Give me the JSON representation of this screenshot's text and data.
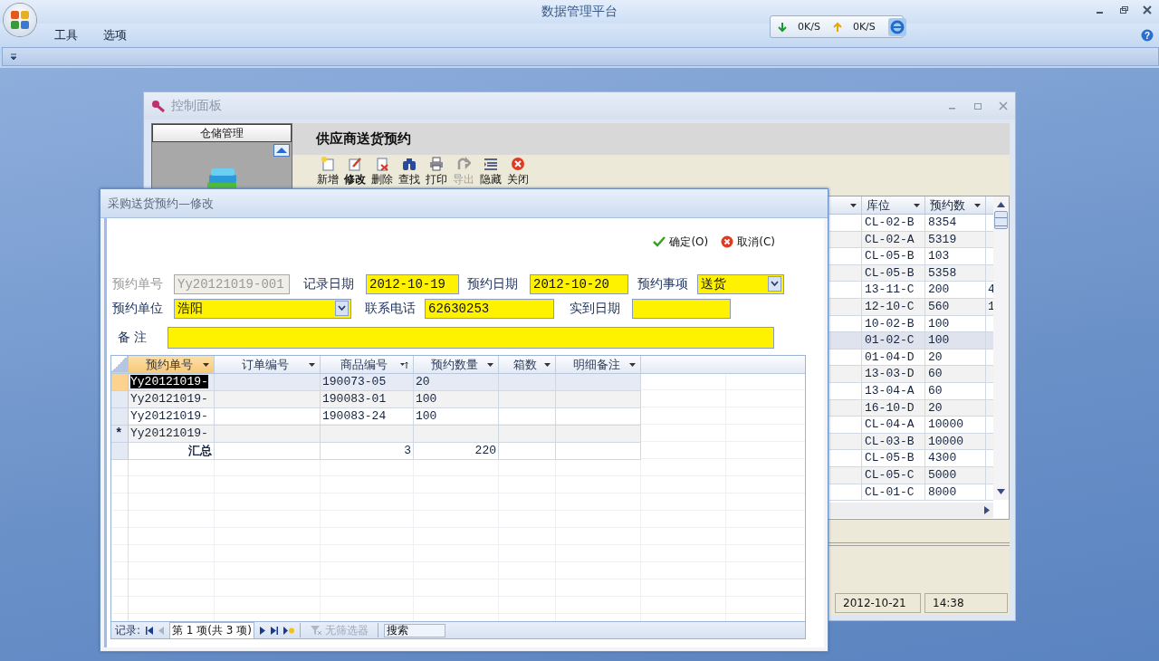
{
  "app": {
    "title": "数据管理平台",
    "menu": [
      {
        "label": "工具"
      },
      {
        "label": "选项"
      }
    ],
    "help": "?"
  },
  "net_speed": {
    "down": "0K/S",
    "up": "0K/S"
  },
  "control_panel": {
    "title": "控制面板",
    "nav_header": "仓储管理",
    "page_title": "供应商送货预约",
    "toolbar": [
      {
        "kind": "new",
        "label": "新增",
        "selected": false,
        "disabled": false
      },
      {
        "kind": "edit",
        "label": "修改",
        "selected": true,
        "disabled": false
      },
      {
        "kind": "delete",
        "label": "删除",
        "selected": false,
        "disabled": false
      },
      {
        "kind": "find",
        "label": "查找",
        "selected": false,
        "disabled": false
      },
      {
        "kind": "print",
        "label": "打印",
        "selected": false,
        "disabled": false
      },
      {
        "kind": "export",
        "label": "导出",
        "selected": false,
        "disabled": true
      },
      {
        "kind": "hide",
        "label": "隐藏",
        "selected": false,
        "disabled": false
      },
      {
        "kind": "close",
        "label": "关闭",
        "selected": false,
        "disabled": false
      }
    ],
    "grid": {
      "columns": [
        {
          "label": "库位"
        },
        {
          "label": "预约数"
        }
      ],
      "rows": [
        {
          "location": "CL-02-B",
          "qty": "8354",
          "selected": false
        },
        {
          "location": "CL-02-A",
          "qty": "5319",
          "selected": false
        },
        {
          "location": "CL-05-B",
          "qty": "103",
          "selected": false
        },
        {
          "location": "CL-05-B",
          "qty": "5358",
          "selected": false
        },
        {
          "location": "13-11-C",
          "qty": "200",
          "column_5": "4",
          "selected": false
        },
        {
          "location": "12-10-C",
          "qty": "560",
          "column_5": "1",
          "selected": false
        },
        {
          "location": "10-02-B",
          "qty": "100",
          "selected": false
        },
        {
          "location": "01-02-C",
          "qty": "100",
          "selected": true
        },
        {
          "location": "01-04-D",
          "qty": "20",
          "selected": false
        },
        {
          "location": "13-03-D",
          "qty": "60",
          "selected": false
        },
        {
          "location": "13-04-A",
          "qty": "60",
          "selected": false
        },
        {
          "location": "16-10-D",
          "qty": "20",
          "selected": false
        },
        {
          "location": "CL-04-A",
          "qty": "10000",
          "selected": false
        },
        {
          "location": "CL-03-B",
          "qty": "10000",
          "selected": false
        },
        {
          "location": "CL-05-B",
          "qty": "4300",
          "selected": false
        },
        {
          "location": "CL-05-C",
          "qty": "5000",
          "selected": false
        },
        {
          "location": "CL-01-C",
          "qty": "8000",
          "selected": false
        }
      ]
    },
    "status_bar": [
      "2012-10-21",
      "14:38"
    ]
  },
  "dialog": {
    "title": "采购送货预约—修改",
    "actions": [
      {
        "kind": "ok",
        "label": "确定(O)"
      },
      {
        "kind": "cancel",
        "label": "取消(C)"
      }
    ],
    "form": [
      [
        {
          "label": "预约单号",
          "kind": "text",
          "value": "Yy20121019-001",
          "disabled": true
        },
        {
          "label": "记录日期",
          "kind": "text",
          "value": "2012-10-19",
          "disabled": false
        },
        {
          "label": "预约日期",
          "kind": "text",
          "value": "2012-10-20",
          "disabled": false
        },
        {
          "label": "预约事项",
          "kind": "select",
          "value": "送货",
          "disabled": false
        }
      ],
      [
        {
          "label": "预约单位",
          "kind": "select",
          "value": "浩阳",
          "disabled": false
        },
        {
          "label": "联系电话",
          "kind": "text",
          "value": "62630253",
          "disabled": false
        },
        {
          "label": "实到日期",
          "kind": "text",
          "disabled": false
        }
      ],
      [
        {
          "label": "备 注",
          "kind": "text",
          "disabled": false
        }
      ]
    ],
    "grid": {
      "columns": [
        {
          "label": "预约单号",
          "selected": true,
          "sorted": false
        },
        {
          "label": "订单编号",
          "selected": false,
          "sorted": false
        },
        {
          "label": "商品编号",
          "selected": false,
          "sorted": true
        },
        {
          "label": "预约数量",
          "selected": false,
          "sorted": false
        },
        {
          "label": "箱数",
          "selected": false,
          "sorted": false
        },
        {
          "label": "明细备注",
          "selected": false,
          "sorted": false
        }
      ],
      "rows": [
        {
          "selected": true,
          "cells": [
            "Yy20121019-",
            null,
            "190073-05",
            "20",
            null,
            null
          ]
        },
        {
          "selected": false,
          "cells": [
            "Yy20121019-",
            null,
            "190083-01",
            "100",
            null,
            null
          ]
        },
        {
          "selected": false,
          "cells": [
            "Yy20121019-",
            null,
            "190083-24",
            "100",
            null,
            null
          ]
        },
        {
          "selected": false,
          "marker": "*",
          "cells": [
            "Yy20121019-",
            null,
            null,
            null,
            null,
            null
          ]
        }
      ],
      "totals": {
        "label": "汇总",
        "cells": [
          null,
          "3",
          "220",
          null,
          null
        ]
      },
      "navigator": {
        "label": "记录:",
        "position": "第 1 项(共 3 项)",
        "filter": "无筛选器",
        "search_placeholder": "搜索"
      }
    }
  }
}
